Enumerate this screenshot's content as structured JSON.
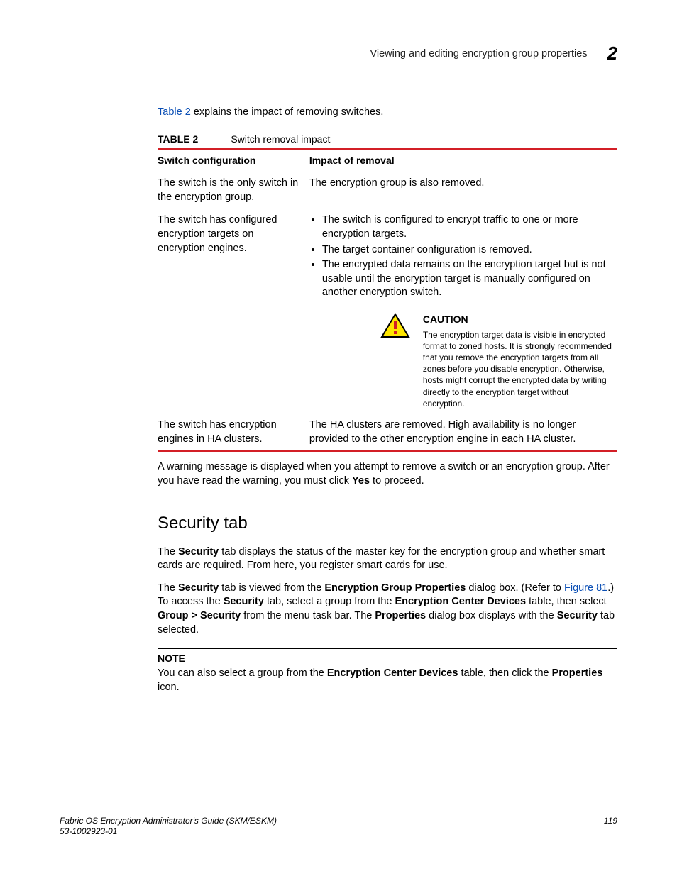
{
  "header": {
    "running_title": "Viewing and editing encryption group properties",
    "chapter_number": "2"
  },
  "intro": {
    "link_text": "Table 2",
    "rest": " explains the impact of removing switches."
  },
  "table": {
    "label": "TABLE 2",
    "title": "Switch removal impact",
    "columns": {
      "c1": "Switch configuration",
      "c2": "Impact of removal"
    },
    "rows": [
      {
        "config": "The switch is the only switch in the encryption group.",
        "impact_text": "The encryption group is also removed."
      },
      {
        "config": "The switch has configured encryption targets on encryption engines.",
        "bullets": [
          "The switch is configured to encrypt traffic to one or more encryption targets.",
          "The target container configuration is removed.",
          "The encrypted data remains on the encryption target but is not usable until the encryption target is manually configured on another encryption switch."
        ],
        "caution": {
          "title": "CAUTION",
          "body": "The encryption target data is visible in encrypted format to zoned hosts. It is strongly recommended that you remove the encryption targets from all zones before you disable encryption. Otherwise, hosts might corrupt the encrypted data by writing directly to the encryption target without encryption."
        }
      },
      {
        "config": "The switch has encryption engines in HA clusters.",
        "impact_text": "The HA clusters are removed. High availability is no longer provided to the other encryption engine in each HA cluster."
      }
    ]
  },
  "after_table": {
    "p1a": "A warning message is displayed when you attempt to remove a switch or an encryption group. After you have read the warning, you must click ",
    "p1b": "Yes",
    "p1c": " to proceed."
  },
  "section": {
    "heading": "Security tab",
    "p1": {
      "a": "The ",
      "b": "Security",
      "c": " tab displays the status of the master key for the encryption group and whether smart cards are required. From here, you register smart cards for use."
    },
    "p2": {
      "a": "The ",
      "b": "Security",
      "c": " tab is viewed from the ",
      "d": "Encryption Group Properties",
      "e": " dialog box. (Refer to ",
      "f": "Figure 81",
      "g": ".) To access the ",
      "h": "Security",
      "i": " tab, select a group from the ",
      "j": "Encryption Center Devices",
      "k": " table, then select ",
      "l": "Group > Security",
      "m": " from the menu task bar. The ",
      "n": "Properties",
      "o": " dialog box displays with the ",
      "p": "Security",
      "q": " tab selected."
    },
    "note": {
      "label": "NOTE",
      "a": "You can also select a group from the ",
      "b": "Encryption Center Devices",
      "c": " table, then click the ",
      "d": "Properties",
      "e": " icon."
    }
  },
  "footer": {
    "book": "Fabric OS Encryption Administrator's Guide (SKM/ESKM)",
    "partno": "53-1002923-01",
    "page": "119"
  }
}
